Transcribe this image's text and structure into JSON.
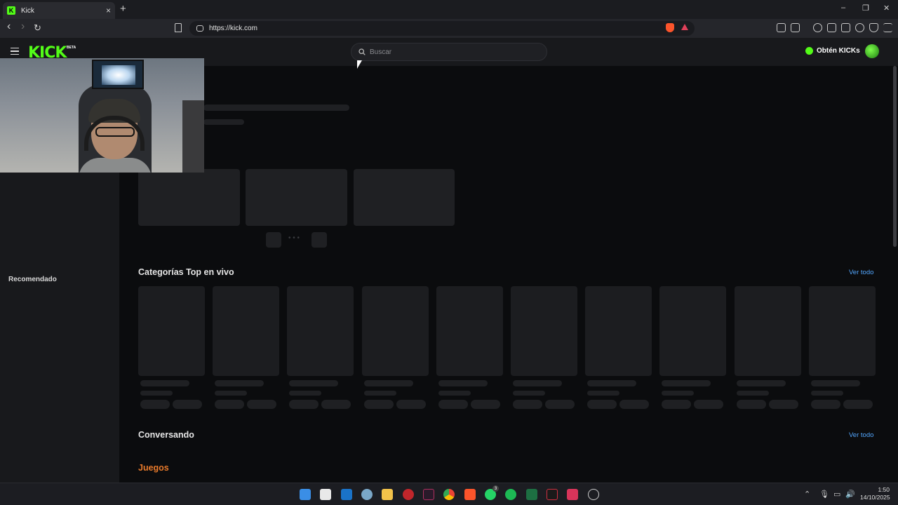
{
  "browser": {
    "tab_title": "Kick",
    "tab_favicon": "K",
    "tab_close": "×",
    "new_tab": "+",
    "url": "https://kick.com",
    "nav": {
      "back": "‹",
      "forward": "›",
      "reload": "↻"
    },
    "window_controls": {
      "minimize": "–",
      "restore": "❐",
      "close": "✕"
    }
  },
  "header": {
    "logo": "KICK",
    "logo_badge": "BETA",
    "search_placeholder": "Buscar",
    "get_kicks": "Obtén KICKs"
  },
  "sidebar": {
    "recommended_label": "Recomendado"
  },
  "sections": {
    "top_categories": {
      "title": "Categorías Top en vivo",
      "see_all": "Ver todo"
    },
    "conversing": {
      "title": "Conversando",
      "see_all": "Ver todo"
    },
    "games": {
      "title": "Juegos"
    }
  },
  "carousel_dots": "• • •",
  "taskbar": {
    "whatsapp_badge": "3",
    "time": "1:50",
    "date": "14/10/2025"
  },
  "colors": {
    "brand_green": "#53fc18",
    "link_blue": "#53a7ff",
    "games_orange": "#e87a2b"
  }
}
